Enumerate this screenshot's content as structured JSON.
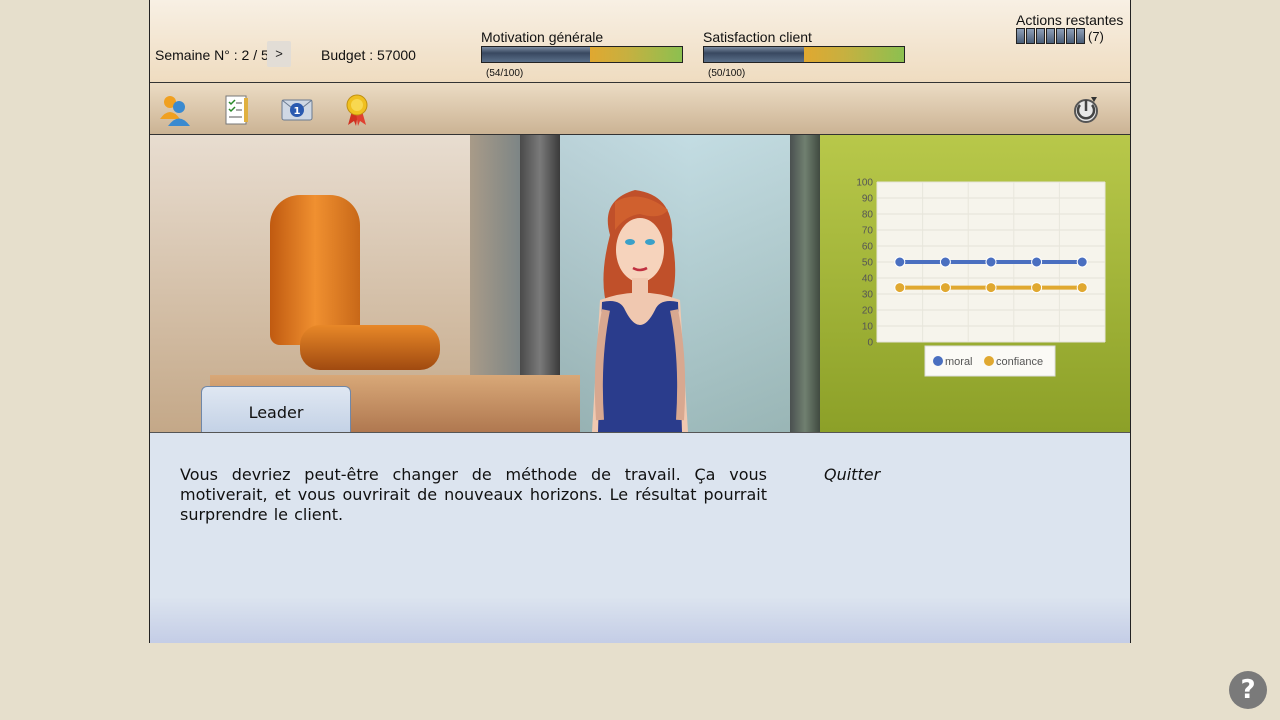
{
  "header": {
    "week_label": "Semaine N° : 2 / 5",
    "next_label": ">",
    "budget_label": "Budget : 57000",
    "motivation": {
      "title": "Motivation générale",
      "value_text": "(54/100)",
      "value": 54
    },
    "satisfaction": {
      "title": "Satisfaction client",
      "value_text": "(50/100)",
      "value": 50
    },
    "actions": {
      "title": "Actions restantes",
      "pips": 7,
      "count_text": "(7)"
    }
  },
  "toolbar": {
    "icons": [
      "team-icon",
      "checklist-icon",
      "message-icon",
      "award-icon",
      "power-icon"
    ]
  },
  "character": {
    "name": "Leader"
  },
  "dialog": {
    "text": "Vous devriez peut-être changer de méthode de travail. Ça vous motiverait, et vous ouvrirait de nouveaux horizons. Le résultat pourrait surprendre le client.",
    "quit_label": "Quitter"
  },
  "help": {
    "label": "?"
  },
  "chart_data": {
    "type": "line",
    "x": [
      1,
      2,
      3,
      4,
      5
    ],
    "y_ticks": [
      "0",
      "10",
      "20",
      "30",
      "40",
      "50",
      "60",
      "70",
      "80",
      "90",
      "100"
    ],
    "ylim": [
      0,
      100
    ],
    "grid": true,
    "legend": "bottom",
    "series": [
      {
        "name": "moral",
        "values": [
          50,
          50,
          50,
          50,
          50
        ],
        "color": "#4a6fc0"
      },
      {
        "name": "confiance",
        "values": [
          34,
          34,
          34,
          34,
          34
        ],
        "color": "#e0a830"
      }
    ]
  }
}
